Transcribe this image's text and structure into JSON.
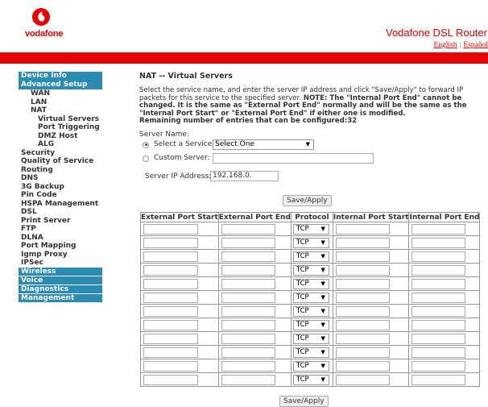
{
  "header": {
    "logo_text": "vodafone",
    "router_title": "Vodafone DSL Router",
    "lang_english": "English",
    "lang_espanol": "Español",
    "lang_separator": "|",
    "brand_color": "#e60000"
  },
  "sidebar": {
    "device_info": "Device Info",
    "advanced_setup": "Advanced Setup",
    "wan": "WAN",
    "lan": "LAN",
    "nat": "NAT",
    "virtual_servers": "Virtual Servers",
    "port_triggering": "Port Triggering",
    "dmz_host": "DMZ Host",
    "alg": "ALG",
    "security": "Security",
    "qos": "Quality of Service",
    "routing": "Routing",
    "dns": "DNS",
    "backup_3g": "3G Backup",
    "pin_code": "Pin Code",
    "hspa": "HSPA Management",
    "dsl": "DSL",
    "print_server": "Print Server",
    "ftp": "FTP",
    "dlna": "DLNA",
    "port_mapping": "Port Mapping",
    "igmp_proxy": "Igmp Proxy",
    "ipsec": "IPSec",
    "wireless": "Wireless",
    "voice": "Voice",
    "diagnostics": "Diagnostics",
    "management": "Management",
    "nav_color": "#2a8bb3"
  },
  "main": {
    "title": "NAT -- Virtual Servers",
    "intro_plain": "Select the service name, and enter the server IP address and click \"Save/Apply\" to forward IP packets for this service to the specified server. ",
    "intro_note": "NOTE: The \"Internal Port End\" cannot be changed. It is the same as \"External Port End\" normally and will be the same as the \"Internal Port Start\" or \"External Port End\" if either one is modified.",
    "remaining": "Remaining number of entries that can be configured:32",
    "server_name_label": "Server Name:",
    "select_service_label": "Select a Service:",
    "select_service_value": "Select One",
    "custom_server_label": "Custom Server:",
    "custom_server_value": "",
    "server_ip_label": "Server IP Address:",
    "server_ip_value": "192.168.0.",
    "save_apply": "Save/Apply",
    "save_apply_bottom": "Save/Apply"
  },
  "table": {
    "headers": [
      "External Port Start",
      "External Port End",
      "Protocol",
      "Internal Port Start",
      "Internal Port End"
    ],
    "rows": [
      {
        "protocol": "TCP"
      },
      {
        "protocol": "TCP"
      },
      {
        "protocol": "TCP"
      },
      {
        "protocol": "TCP"
      },
      {
        "protocol": "TCP"
      },
      {
        "protocol": "TCP"
      },
      {
        "protocol": "TCP"
      },
      {
        "protocol": "TCP"
      },
      {
        "protocol": "TCP"
      },
      {
        "protocol": "TCP"
      },
      {
        "protocol": "TCP"
      },
      {
        "protocol": "TCP"
      }
    ]
  },
  "icons": {
    "dropdown": "chevron-down-icon",
    "logo": "vodafone-logo-icon"
  }
}
